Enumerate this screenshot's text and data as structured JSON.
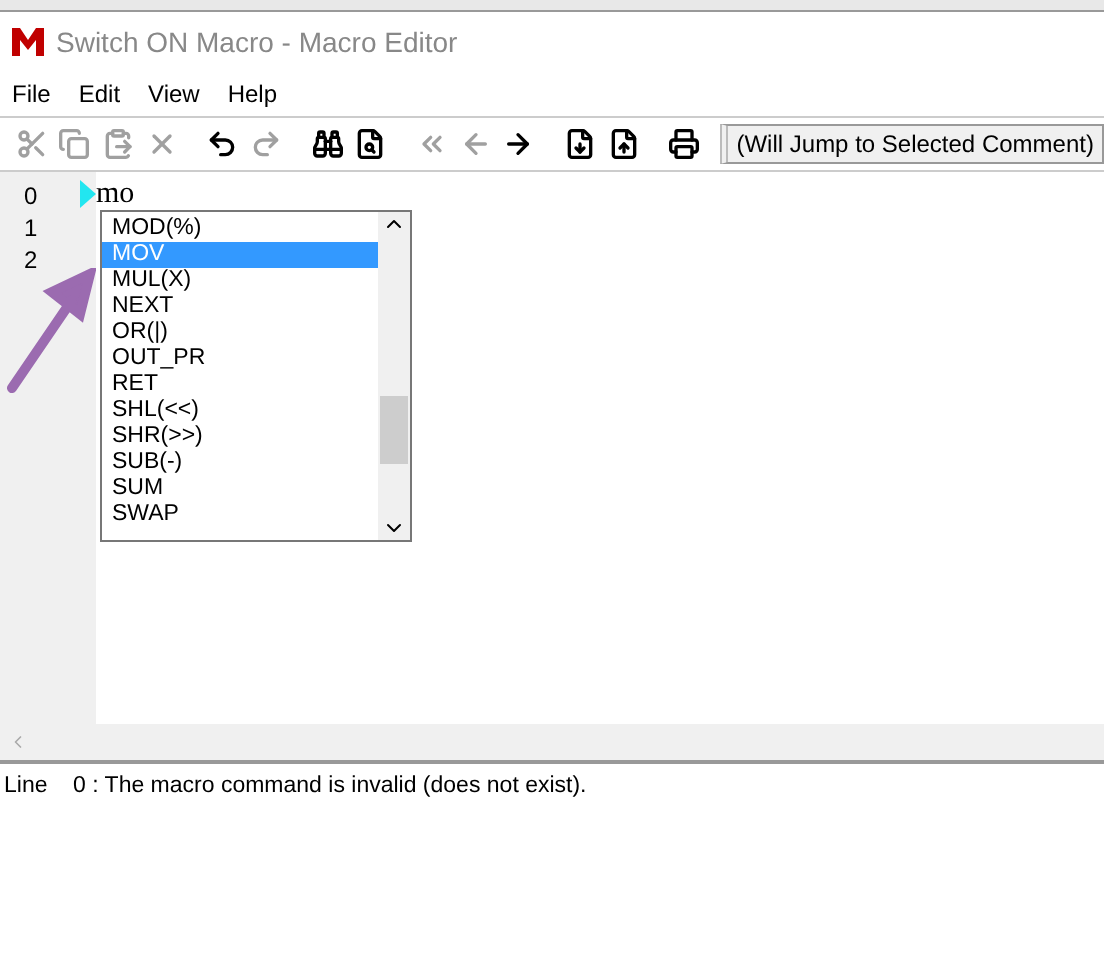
{
  "window": {
    "title": "Switch ON Macro - Macro Editor"
  },
  "menu": [
    {
      "label": "File"
    },
    {
      "label": "Edit"
    },
    {
      "label": "View"
    },
    {
      "label": "Help"
    }
  ],
  "toolbar": {
    "buttons": [
      {
        "kind": "cut",
        "disabled": true
      },
      {
        "kind": "copy",
        "disabled": true
      },
      {
        "kind": "paste",
        "disabled": true
      },
      {
        "kind": "delete",
        "disabled": true
      },
      {
        "kind": "gap"
      },
      {
        "kind": "undo",
        "disabled": false
      },
      {
        "kind": "redo",
        "disabled": true
      },
      {
        "kind": "gap"
      },
      {
        "kind": "find",
        "disabled": false
      },
      {
        "kind": "find-files",
        "disabled": false
      },
      {
        "kind": "gap"
      },
      {
        "kind": "jump",
        "disabled": true
      },
      {
        "kind": "back",
        "disabled": true
      },
      {
        "kind": "forward",
        "disabled": false
      },
      {
        "kind": "gap"
      },
      {
        "kind": "export",
        "disabled": false
      },
      {
        "kind": "import",
        "disabled": false
      },
      {
        "kind": "gap"
      },
      {
        "kind": "print",
        "disabled": false
      }
    ],
    "jump_field": "(Will Jump to Selected Comment)"
  },
  "editor": {
    "lines": [
      {
        "number": "0",
        "text": "mo",
        "current": true
      },
      {
        "number": "1",
        "current": false
      },
      {
        "number": "2",
        "current": false
      }
    ],
    "autocomplete": [
      {
        "label": "MOD(%)",
        "selected": false
      },
      {
        "label": "MOV",
        "selected": true
      },
      {
        "label": "MUL(X)",
        "selected": false
      },
      {
        "label": "NEXT",
        "selected": false
      },
      {
        "label": "OR(|)",
        "selected": false
      },
      {
        "label": "OUT_PR",
        "selected": false
      },
      {
        "label": "RET",
        "selected": false
      },
      {
        "label": "SHL(<<)",
        "selected": false
      },
      {
        "label": "SHR(>>)",
        "selected": false
      },
      {
        "label": "SUB(-)",
        "selected": false
      },
      {
        "label": "SUM",
        "selected": false
      },
      {
        "label": "SWAP",
        "selected": false
      }
    ]
  },
  "messages": [
    {
      "line": "Line",
      "number": "0",
      "text": ": The macro command is invalid (does not exist)."
    }
  ]
}
